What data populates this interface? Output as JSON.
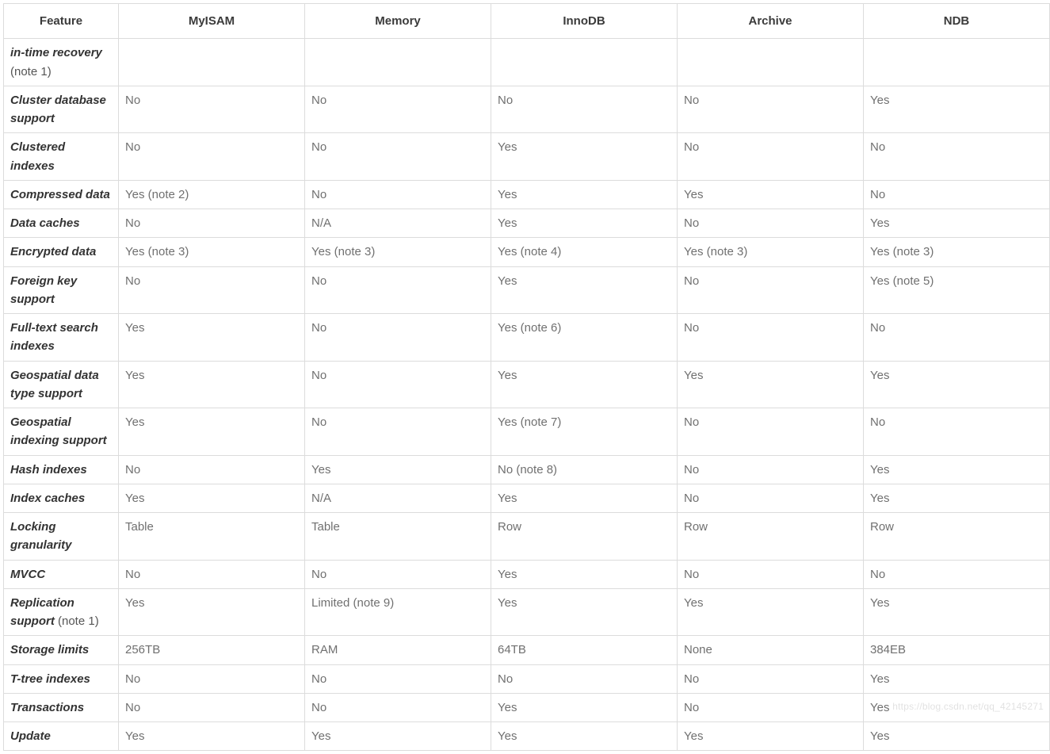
{
  "table": {
    "headers": [
      "Feature",
      "MyISAM",
      "Memory",
      "InnoDB",
      "Archive",
      "NDB"
    ],
    "rows": [
      {
        "feature": "in-time recovery",
        "note": "(note 1)",
        "values": [
          "",
          "",
          "",
          "",
          ""
        ]
      },
      {
        "feature": "Cluster database support",
        "note": "",
        "values": [
          "No",
          "No",
          "No",
          "No",
          "Yes"
        ]
      },
      {
        "feature": "Clustered indexes",
        "note": "",
        "values": [
          "No",
          "No",
          "Yes",
          "No",
          "No"
        ]
      },
      {
        "feature": "Compressed data",
        "note": "",
        "values": [
          "Yes (note 2)",
          "No",
          "Yes",
          "Yes",
          "No"
        ]
      },
      {
        "feature": "Data caches",
        "note": "",
        "values": [
          "No",
          "N/A",
          "Yes",
          "No",
          "Yes"
        ]
      },
      {
        "feature": "Encrypted data",
        "note": "",
        "values": [
          "Yes (note 3)",
          "Yes (note 3)",
          "Yes (note 4)",
          "Yes (note 3)",
          "Yes (note 3)"
        ]
      },
      {
        "feature": "Foreign key support",
        "note": "",
        "values": [
          "No",
          "No",
          "Yes",
          "No",
          "Yes (note 5)"
        ]
      },
      {
        "feature": "Full-text search indexes",
        "note": "",
        "values": [
          "Yes",
          "No",
          "Yes (note 6)",
          "No",
          "No"
        ]
      },
      {
        "feature": "Geospatial data type support",
        "note": "",
        "values": [
          "Yes",
          "No",
          "Yes",
          "Yes",
          "Yes"
        ]
      },
      {
        "feature": "Geospatial indexing support",
        "note": "",
        "values": [
          "Yes",
          "No",
          "Yes (note 7)",
          "No",
          "No"
        ]
      },
      {
        "feature": "Hash indexes",
        "note": "",
        "values": [
          "No",
          "Yes",
          "No (note 8)",
          "No",
          "Yes"
        ]
      },
      {
        "feature": "Index caches",
        "note": "",
        "values": [
          "Yes",
          "N/A",
          "Yes",
          "No",
          "Yes"
        ]
      },
      {
        "feature": "Locking granularity",
        "note": "",
        "values": [
          "Table",
          "Table",
          "Row",
          "Row",
          "Row"
        ]
      },
      {
        "feature": "MVCC",
        "note": "",
        "values": [
          "No",
          "No",
          "Yes",
          "No",
          "No"
        ]
      },
      {
        "feature": "Replication support",
        "note": "(note 1)",
        "values": [
          "Yes",
          "Limited (note 9)",
          "Yes",
          "Yes",
          "Yes"
        ]
      },
      {
        "feature": "Storage limits",
        "note": "",
        "values": [
          "256TB",
          "RAM",
          "64TB",
          "None",
          "384EB"
        ]
      },
      {
        "feature": "T-tree indexes",
        "note": "",
        "values": [
          "No",
          "No",
          "No",
          "No",
          "Yes"
        ]
      },
      {
        "feature": "Transactions",
        "note": "",
        "values": [
          "No",
          "No",
          "Yes",
          "No",
          "Yes"
        ]
      },
      {
        "feature": "Update",
        "note": "",
        "values": [
          "Yes",
          "Yes",
          "Yes",
          "Yes",
          "Yes"
        ]
      }
    ]
  },
  "watermark": "https://blog.csdn.net/qq_42145271"
}
